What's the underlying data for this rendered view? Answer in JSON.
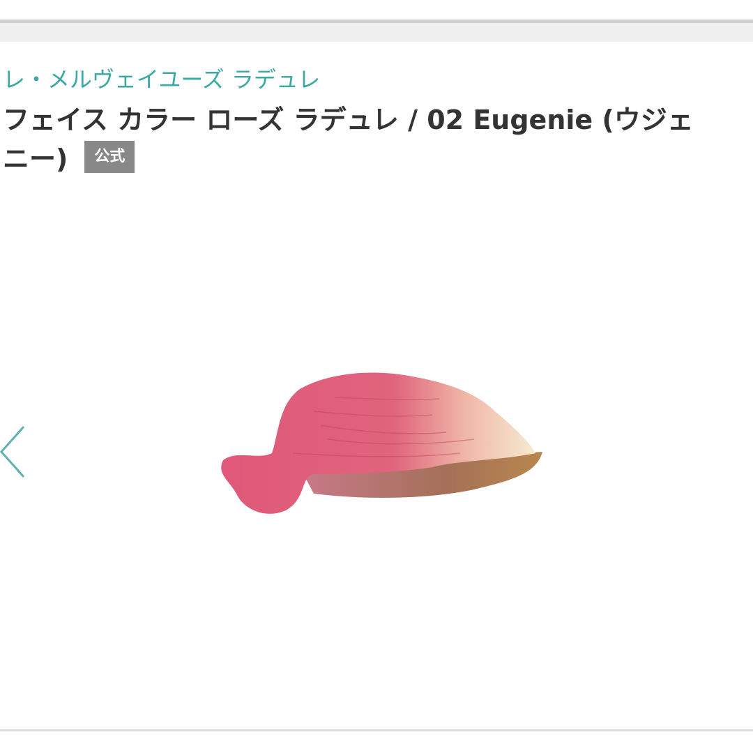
{
  "product": {
    "brand": "レ・メルヴェイユーズ ラデュレ",
    "title_line1": "フェイス カラー ローズ ラデュレ / 02 Eugenie (ウジェ",
    "title_line2": "ニー)",
    "official_badge": "公式"
  },
  "colors": {
    "brand_link": "#3aa9a3",
    "title": "#333333",
    "badge_bg": "#888888",
    "arrow": "#5fb0ae",
    "petal_pink": "#e0587a",
    "petal_cream": "#f3e6c8",
    "petal_brown": "#9a6d52"
  },
  "icons": {
    "prev": "chevron-left-icon"
  }
}
